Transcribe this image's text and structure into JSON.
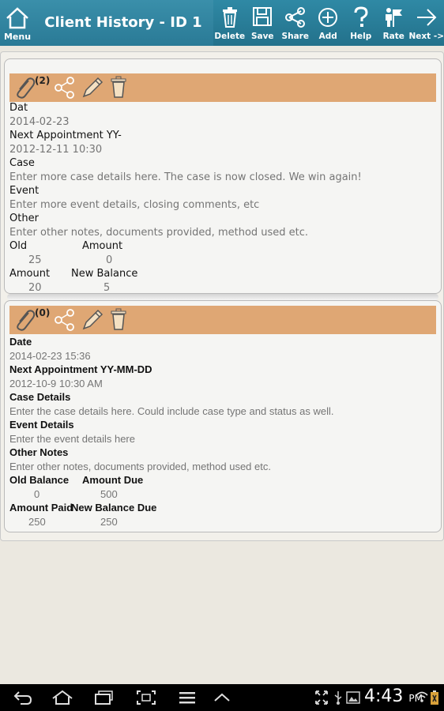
{
  "actionbar": {
    "home_label": "Menu",
    "title": "Client History - ID 1",
    "actions": [
      {
        "label": "Delete",
        "icon": "trash-icon"
      },
      {
        "label": "Save",
        "icon": "floppy-icon"
      },
      {
        "label": "Share",
        "icon": "share-icon"
      },
      {
        "label": "Add",
        "icon": "plus-circle-icon"
      },
      {
        "label": "Help",
        "icon": "question-icon"
      },
      {
        "label": "Rate",
        "icon": "rate-icon"
      },
      {
        "label": "Next ->",
        "icon": "arrow-right-icon"
      }
    ],
    "bg_color": "#2f86a2"
  },
  "records": [
    {
      "attachment_count": "(2)",
      "date_label": "Dat",
      "date_value": "2014-02-23",
      "next_label": "Next Appointment YY-",
      "next_value": "2012-12-11  10:30",
      "case_label": "Case",
      "case_value": "Enter more case details here. The case is now closed. We win again!",
      "event_label": "Event",
      "event_value": "Enter more event details, closing comments, etc",
      "other_label": "Other",
      "other_value": "Enter other notes, documents provided, method used etc.",
      "old_label": "Old",
      "amount_label": "Amount",
      "old_value": "25",
      "amount_value": "0",
      "paid_label": "Amount",
      "newbal_label": "New Balance",
      "paid_value": "20",
      "newbal_value": "5"
    },
    {
      "attachment_count": "(0)",
      "date_label": "Date",
      "date_value": "2014-02-23 15:36",
      "next_label": "Next Appointment YY-MM-DD",
      "next_value": "2012-10-9  10:30 AM",
      "case_label": "Case Details",
      "case_value": "Enter the case details here. Could include case type and status as well.",
      "event_label": "Event Details",
      "event_value": "Enter the event details here",
      "other_label": "Other Notes",
      "other_value": "Enter other notes, documents provided, method used etc.",
      "old_label": "Old Balance",
      "amount_label": "Amount Due",
      "old_value": "0",
      "amount_value": "500",
      "paid_label": "Amount Paid",
      "newbal_label": "New Balance Due",
      "paid_value": "250",
      "newbal_value": "250"
    }
  ],
  "toolbar_color": "#dfa774",
  "statusbar": {
    "time": "4:43",
    "ampm": "PM"
  }
}
